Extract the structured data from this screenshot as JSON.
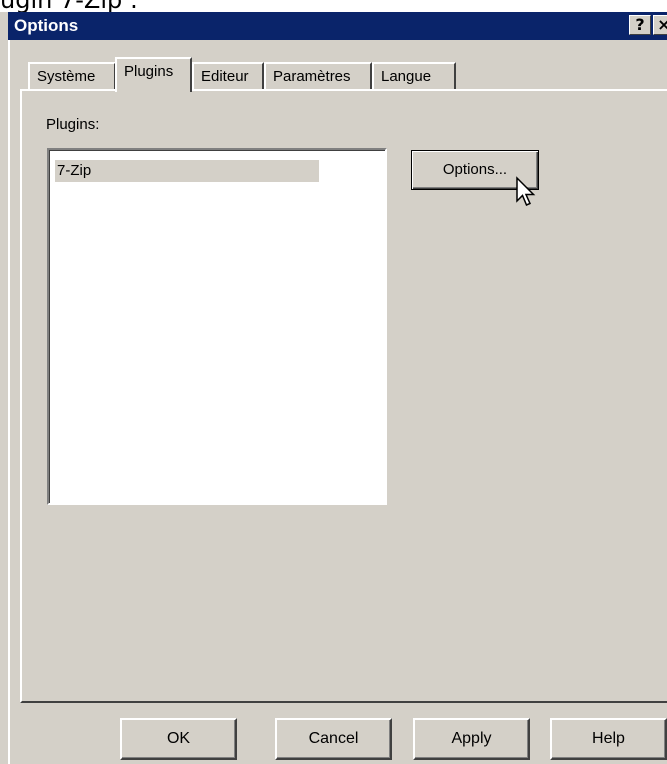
{
  "top_strip": {
    "text": "ugin 7-Zip :"
  },
  "window": {
    "title": "Options",
    "help_button": "?",
    "close_button": "×"
  },
  "tabs": [
    {
      "label": "Système",
      "active": false
    },
    {
      "label": "Plugins",
      "active": true
    },
    {
      "label": "Editeur",
      "active": false
    },
    {
      "label": "Paramètres",
      "active": false
    },
    {
      "label": "Langue",
      "active": false
    }
  ],
  "plugins_page": {
    "label": "Plugins:",
    "items": [
      "7-Zip"
    ],
    "options_button": "Options..."
  },
  "buttons": {
    "ok": "OK",
    "cancel": "Cancel",
    "apply": "Apply",
    "help": "Help"
  },
  "icons": {
    "cursor": "arrow-cursor-icon"
  },
  "colors": {
    "titlebar": "#0a246a",
    "face": "#d4d0c8",
    "selection": "#d4d0c8"
  }
}
